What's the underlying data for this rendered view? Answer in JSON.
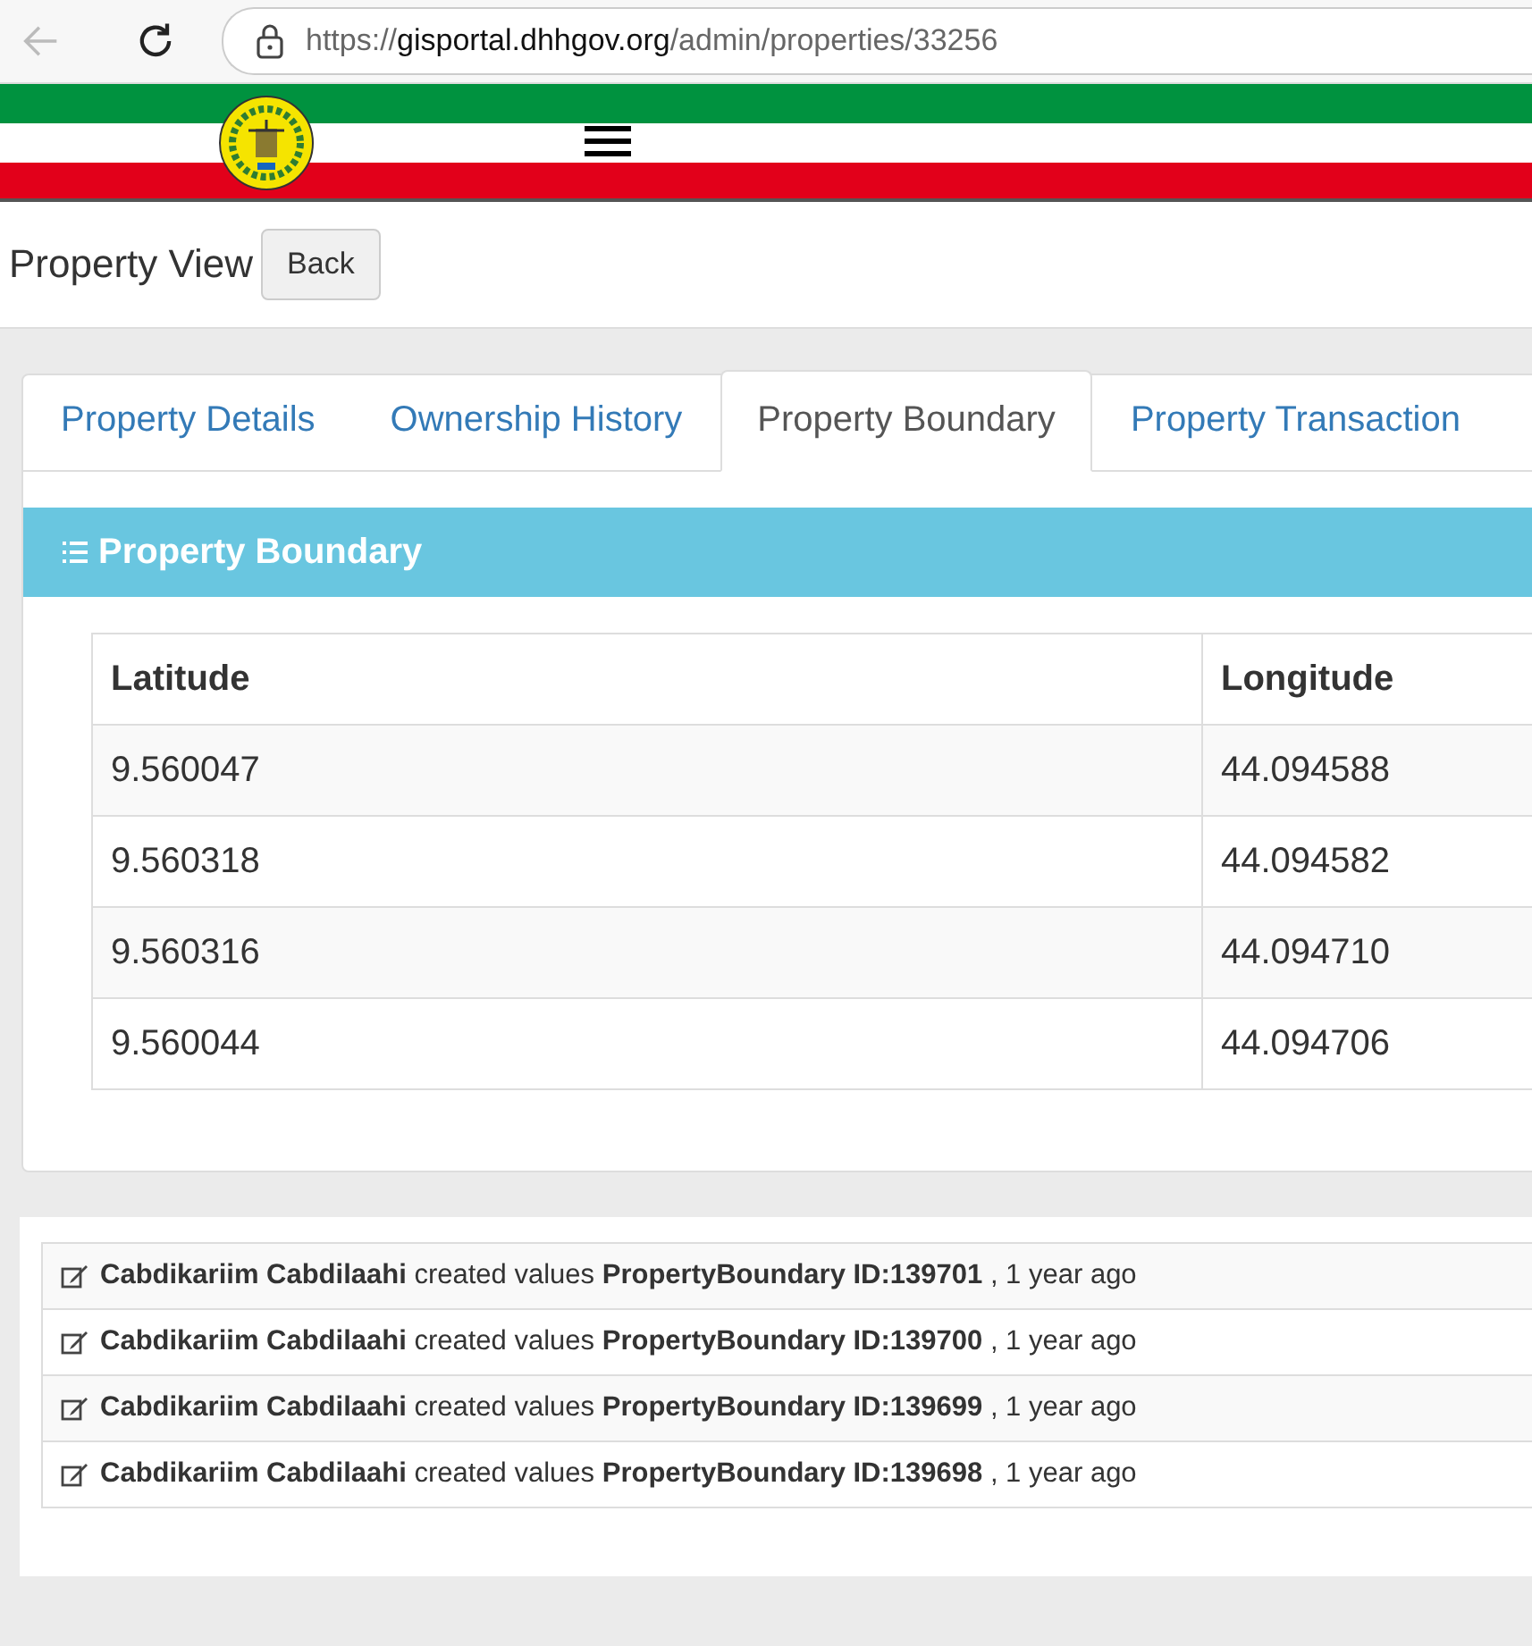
{
  "browser": {
    "url": {
      "scheme": "https://",
      "host": "gisportal.dhhgov.org",
      "path": "/admin/properties/33256"
    }
  },
  "page": {
    "title": "Property View",
    "back_button": "Back"
  },
  "tabs": [
    {
      "label": "Property Details",
      "selected": false
    },
    {
      "label": "Ownership History",
      "selected": false
    },
    {
      "label": "Property Boundary",
      "selected": true
    },
    {
      "label": "Property Transaction",
      "selected": false
    }
  ],
  "panel": {
    "title": "Property Boundary"
  },
  "table": {
    "columns": [
      "Latitude",
      "Longitude"
    ],
    "rows": [
      [
        "9.560047",
        "44.094588"
      ],
      [
        "9.560318",
        "44.094582"
      ],
      [
        "9.560316",
        "44.094710"
      ],
      [
        "9.560044",
        "44.094706"
      ]
    ]
  },
  "activity_log": [
    {
      "text": "**Cabdikariim Cabdilaahi** created values **PropertyBoundary ID:139701** , 1 year ago"
    },
    {
      "text": "**Cabdikariim Cabdilaahi** created values **PropertyBoundary ID:139700** , 1 year ago"
    },
    {
      "text": "**Cabdikariim Cabdilaahi** created values **PropertyBoundary ID:139699** , 1 year ago"
    },
    {
      "text": "**Cabdikariim Cabdilaahi** created values **PropertyBoundary ID:139698** , 1 year ago"
    }
  ]
}
